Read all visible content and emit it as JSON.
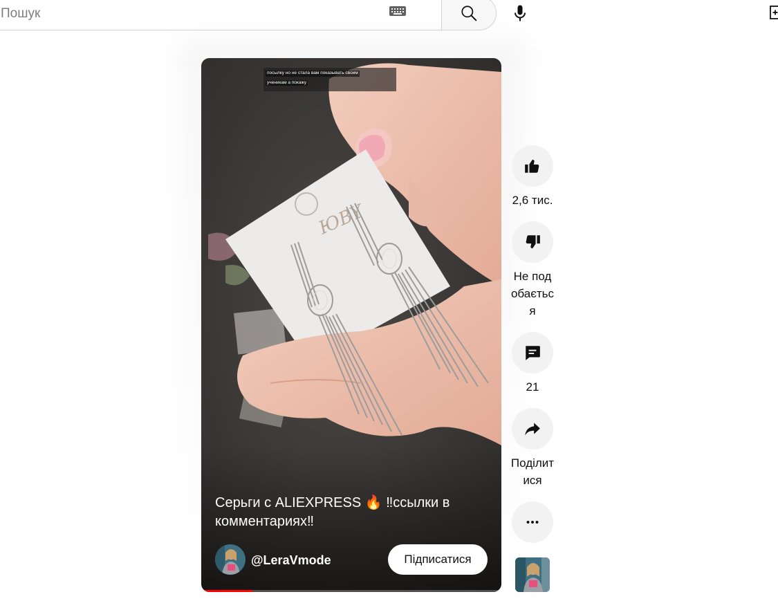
{
  "search": {
    "placeholder": "Пошук",
    "value": ""
  },
  "header": {
    "icons": [
      "keyboard-icon",
      "search-icon",
      "microphone-icon",
      "create-icon"
    ]
  },
  "video": {
    "caption_lines": [
      "посылку но не стала вам показывать своим",
      "ученикам а покажу"
    ],
    "title": "Серьги с ALIEXPRESS 🔥 ‼ссылки в комментариях‼",
    "channel": "@LeraVmode",
    "subscribe_label": "Підписатися",
    "progress": 0.17
  },
  "actions": {
    "like_count": "2,6 тис.",
    "dislike_label": "Не подобається",
    "comment_count": "21",
    "share_label": "Поділитися",
    "more_icon": "more-horizontal-icon"
  },
  "colors": {
    "progress": "#ff0000",
    "action_bg": "#f2f2f2",
    "subscribe_bg": "#ffffff"
  }
}
